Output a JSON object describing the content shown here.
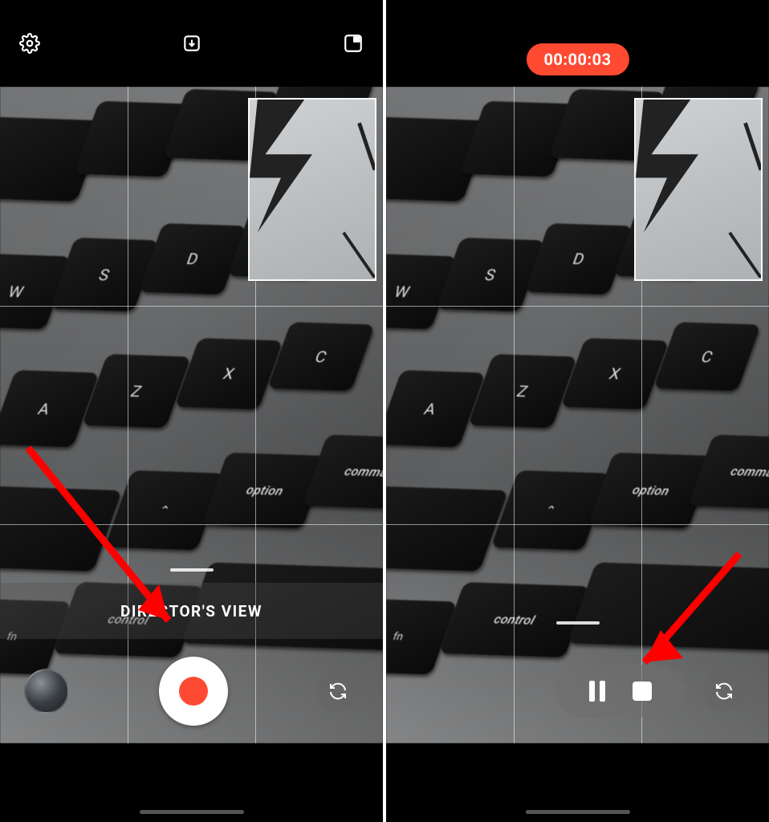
{
  "left": {
    "mode_label": "DIRECTOR'S VIEW",
    "icons": {
      "settings": "settings-icon",
      "save": "save-icon",
      "layout": "layout-icon"
    }
  },
  "right": {
    "recording_time": "00:00:03"
  },
  "colors": {
    "accent_red": "#ff4931",
    "annotation_red": "#ff0000"
  }
}
